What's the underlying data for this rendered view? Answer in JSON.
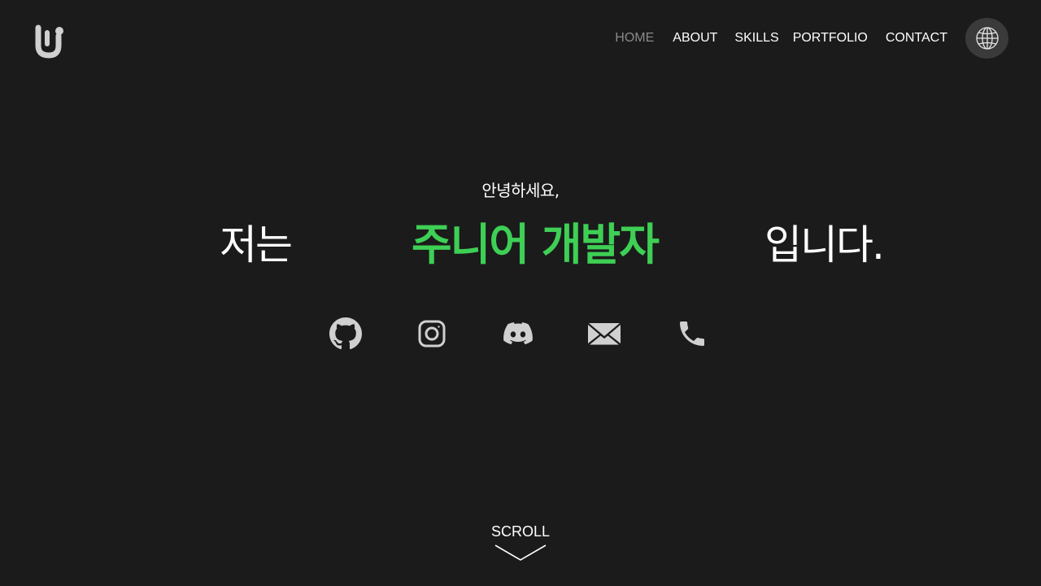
{
  "header": {
    "logo_icon": "brand-logo-icon",
    "nav": [
      {
        "label": "HOME",
        "active": true
      },
      {
        "label": "ABOUT"
      },
      {
        "label": "SKILLS"
      },
      {
        "label": "PORTFOLIO"
      },
      {
        "label": "CONTACT"
      }
    ],
    "language_icon": "globe-icon"
  },
  "hero": {
    "greeting": "안녕하세요,",
    "prefix": "저는",
    "highlight": "주니어 개발자",
    "suffix": "입니다.",
    "accent_color": "#3ecf55"
  },
  "social": [
    {
      "icon": "github-icon"
    },
    {
      "icon": "instagram-icon"
    },
    {
      "icon": "discord-icon"
    },
    {
      "icon": "mail-icon"
    },
    {
      "icon": "phone-icon"
    }
  ],
  "scroll": {
    "label": "SCROLL",
    "icon": "chevron-down-icon"
  },
  "colors": {
    "background": "#1b1b1b",
    "icon": "#d0d0d0",
    "nav_active": "#8a8a8a"
  }
}
